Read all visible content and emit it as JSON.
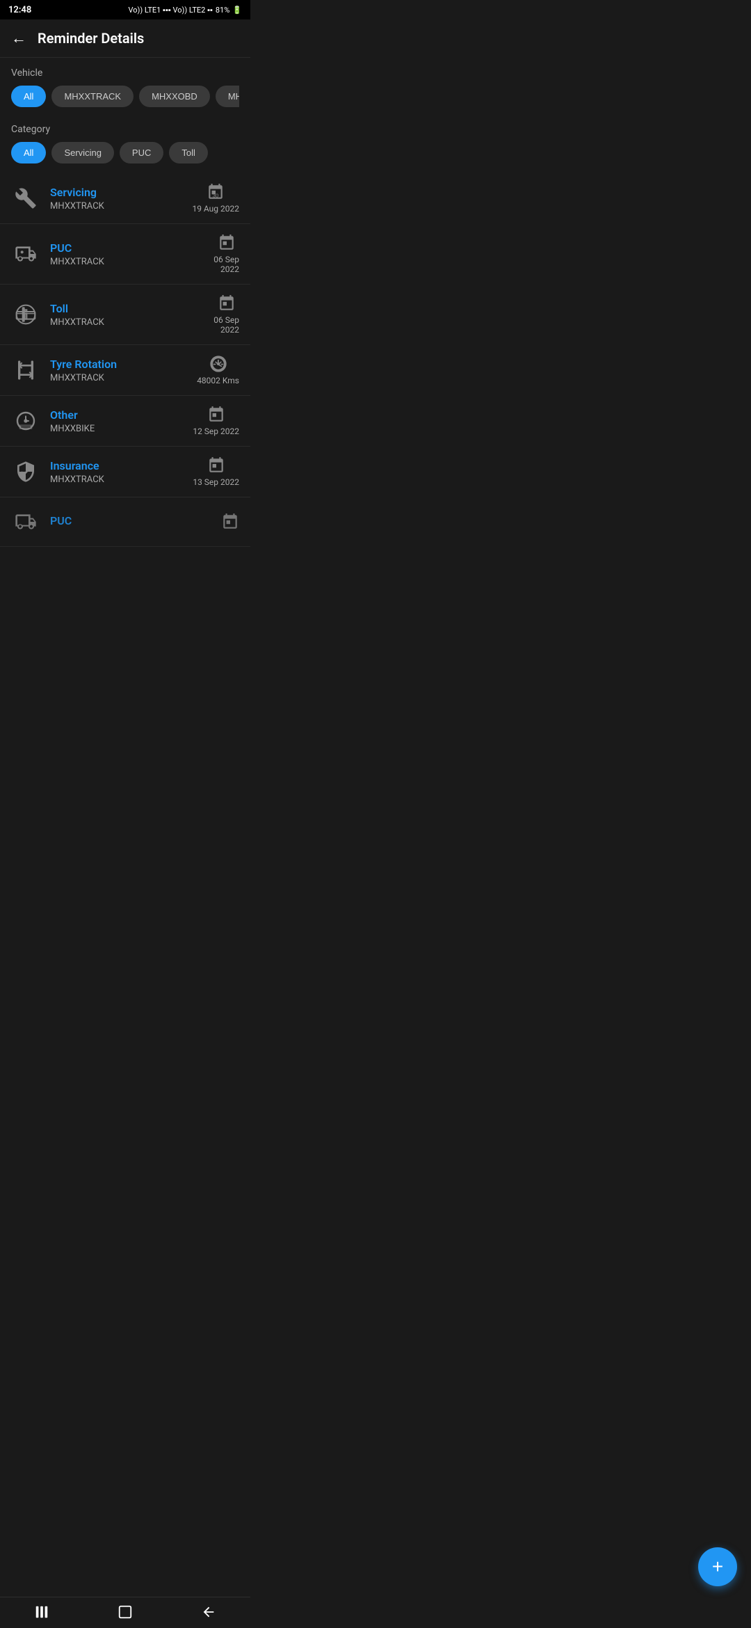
{
  "statusBar": {
    "time": "12:48",
    "battery": "81%",
    "signal": "LTE"
  },
  "header": {
    "backLabel": "←",
    "title": "Reminder Details"
  },
  "vehicleFilter": {
    "label": "Vehicle",
    "chips": [
      {
        "id": "all",
        "label": "All",
        "active": true
      },
      {
        "id": "mhxxtrack",
        "label": "MHXXTRACK",
        "active": false
      },
      {
        "id": "mhxxobd",
        "label": "MHXXOBD",
        "active": false
      },
      {
        "id": "mhxxbike",
        "label": "MHXXBIKE",
        "active": false
      }
    ]
  },
  "categoryFilter": {
    "label": "Category",
    "chips": [
      {
        "id": "all",
        "label": "All",
        "active": true
      },
      {
        "id": "servicing",
        "label": "Servicing",
        "active": false
      },
      {
        "id": "puc",
        "label": "PUC",
        "active": false
      },
      {
        "id": "toll",
        "label": "Toll",
        "active": false
      }
    ]
  },
  "reminders": [
    {
      "id": "r1",
      "title": "Servicing",
      "vehicle": "MHXXTRACK",
      "dateType": "calendar",
      "dateText": "19 Aug 2022",
      "iconType": "wrench"
    },
    {
      "id": "r2",
      "title": "PUC",
      "vehicle": "MHXXTRACK",
      "dateType": "calendar",
      "dateText": "06 Sep\n2022",
      "iconType": "truck"
    },
    {
      "id": "r3",
      "title": "Toll",
      "vehicle": "MHXXTRACK",
      "dateType": "calendar",
      "dateText": "06 Sep\n2022",
      "iconType": "toll"
    },
    {
      "id": "r4",
      "title": "Tyre Rotation",
      "vehicle": "MHXXTRACK",
      "dateType": "odometer",
      "dateText": "48002 Kms",
      "iconType": "tyre"
    },
    {
      "id": "r5",
      "title": "Other",
      "vehicle": "MHXXBIKE",
      "dateType": "calendar",
      "dateText": "12 Sep 2022",
      "iconType": "clock"
    },
    {
      "id": "r6",
      "title": "Insurance",
      "vehicle": "MHXXTRACK",
      "dateType": "calendar",
      "dateText": "13 Sep 2022",
      "iconType": "shield"
    },
    {
      "id": "r7",
      "title": "PUC",
      "vehicle": "",
      "dateType": "calendar",
      "dateText": "",
      "iconType": "truck"
    }
  ],
  "fab": {
    "label": "+"
  },
  "nav": {
    "recents": "|||",
    "home": "□",
    "back": "<"
  }
}
